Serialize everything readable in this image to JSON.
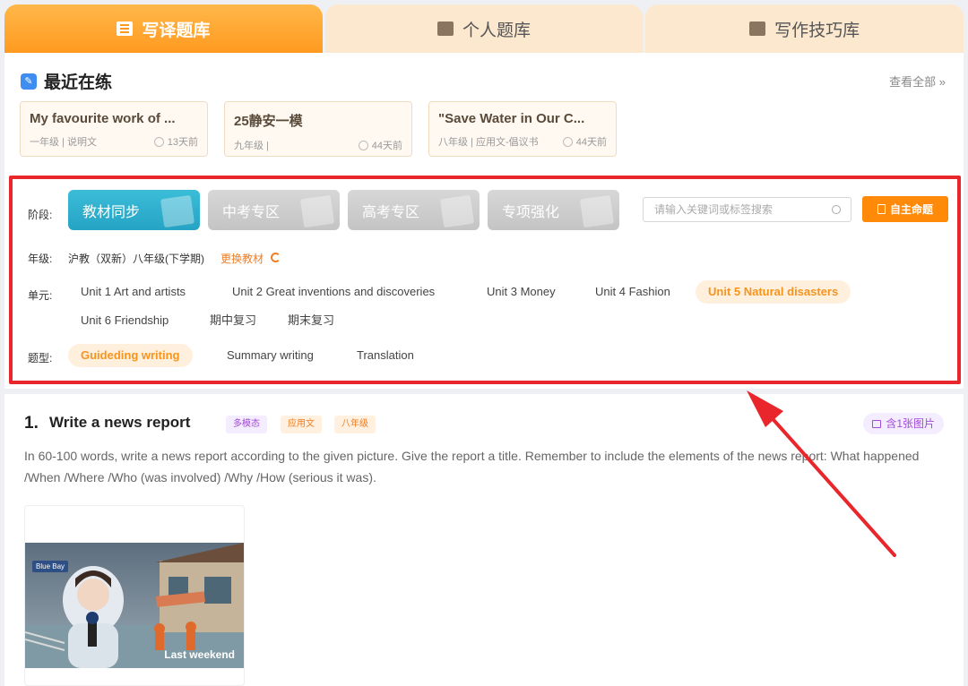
{
  "tabs": [
    {
      "label": "写译题库",
      "active": true,
      "icon": "list-icon"
    },
    {
      "label": "个人题库",
      "active": false,
      "icon": "image-icon"
    },
    {
      "label": "写作技巧库",
      "active": false,
      "icon": "edit-icon"
    }
  ],
  "recent": {
    "title": "最近在练",
    "view_all": "查看全部 »",
    "cards": [
      {
        "title": "My favourite work of ...",
        "meta": "一年级 | 说明文",
        "time": "13天前"
      },
      {
        "title": "25静安一模",
        "meta": "九年级 |",
        "time": "44天前"
      },
      {
        "title": "\"Save Water in Our C...",
        "meta": "八年级 | 应用文-倡议书",
        "time": "44天前"
      }
    ]
  },
  "filter": {
    "stage_label": "阶段:",
    "stages": [
      {
        "label": "教材同步",
        "active": true
      },
      {
        "label": "中考专区",
        "active": false
      },
      {
        "label": "高考专区",
        "active": false
      },
      {
        "label": "专项强化",
        "active": false
      }
    ],
    "search_placeholder": "请输入关键词或标签搜索",
    "self_button": "自主命题",
    "grade_label": "年级:",
    "grade_value": "沪教（双新）八年级(下学期)",
    "change_book": "更换教材",
    "unit_label": "单元:",
    "units": [
      {
        "label": "Unit 1 Art and artists",
        "active": false
      },
      {
        "label": "Unit 2 Great inventions and discoveries",
        "active": false
      },
      {
        "label": "Unit 3 Money",
        "active": false
      },
      {
        "label": "Unit 4 Fashion",
        "active": false
      },
      {
        "label": "Unit 5 Natural disasters",
        "active": true
      },
      {
        "label": "Unit 6 Friendship",
        "active": false
      },
      {
        "label": "期中复习",
        "active": false
      },
      {
        "label": "期末复习",
        "active": false
      }
    ],
    "type_label": "题型:",
    "types": [
      {
        "label": "Guideding writing",
        "active": true
      },
      {
        "label": "Summary writing",
        "active": false
      },
      {
        "label": "Translation",
        "active": false
      }
    ]
  },
  "question": {
    "number": "1.",
    "title": "Write a news report",
    "tags": [
      "多模态",
      "应用文",
      "八年级"
    ],
    "image_count": "含1张图片",
    "body": "In 60-100 words, write a news report according to the given picture. Give the report a title. Remember to include the elements of the news report: What happened /When /Where /Who (was involved) /Why /How (serious it was).",
    "image_caption": "Last weekend",
    "image_sign": "Blue Bay"
  },
  "colors": {
    "accent": "#ff9a1f",
    "highlight_box": "#e8262c",
    "stage_active": "#26a3c4",
    "tag_purple": "#a24ad8"
  }
}
